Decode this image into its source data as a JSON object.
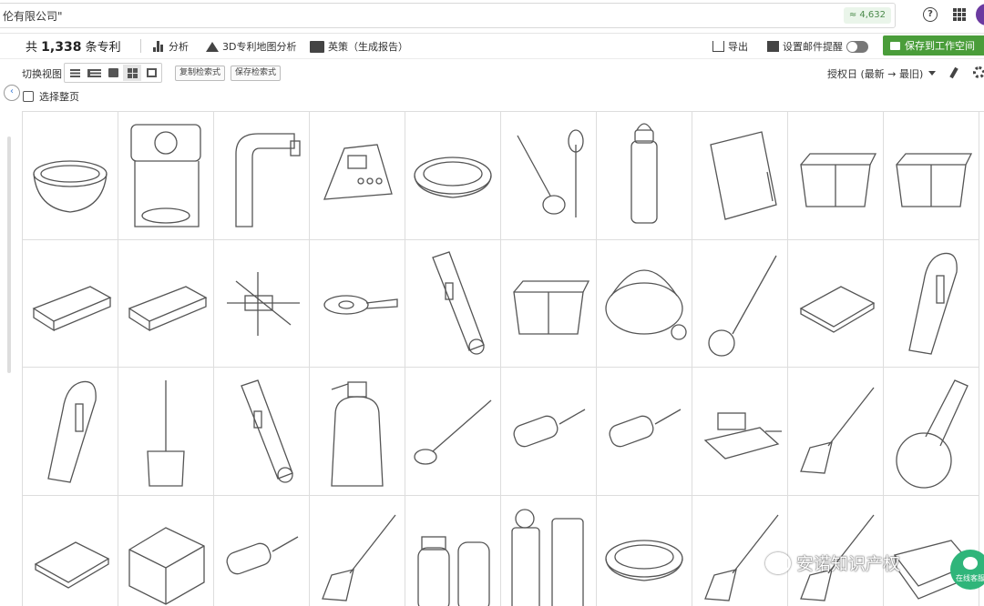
{
  "search": {
    "text": "伦有限公司\"",
    "count": "≈ 4,632"
  },
  "header": {
    "help": "?"
  },
  "toolbar": {
    "total_prefix": "共",
    "total_count": "1,338",
    "total_suffix": "条专利",
    "analysis": "分析",
    "map3d": "3D专利地图分析",
    "insight": "英策（生成报告）",
    "export": "导出",
    "alert": "设置邮件提醒",
    "save_workspace": "保存到工作空间"
  },
  "view": {
    "label": "切换视图",
    "copy_query": "复制检索式",
    "save_query": "保存检索式",
    "sort": "授权日 (最新 → 最旧)",
    "select_page": "选择整页"
  },
  "side": {
    "collapse": "‹"
  },
  "thumbs": [
    "bowl",
    "coffee-maker",
    "faucet-spout",
    "kitchen-scale-keypad",
    "round-dish",
    "bottle-brush-pair",
    "water-bottle",
    "kitchen-scale",
    "storage-bin",
    "storage-bin",
    "drawer-organizer",
    "drawer-organizer",
    "technical-drawing",
    "pan-lid",
    "peeler-tool",
    "storage-bin",
    "salad-spinner",
    "whisk",
    "soap-tray",
    "peeler",
    "peeler",
    "toilet-brush",
    "peeler-tool",
    "soap-dispenser",
    "ladle",
    "hair-brush",
    "hair-brush",
    "dish-rack",
    "spatula",
    "pizza-cutter",
    "soap-tray",
    "lunch-box",
    "hair-brush",
    "spatula",
    "salt-shaker",
    "pepper-grinder",
    "round-dish",
    "spatula",
    "spatula",
    "baking-dish"
  ],
  "watermark": "安诺知识产权",
  "chat": {
    "label": "在线客服"
  },
  "colors": {
    "accent_green": "#4a9d3a",
    "avatar": "#6b3aa0",
    "chat": "#2fb57a"
  }
}
